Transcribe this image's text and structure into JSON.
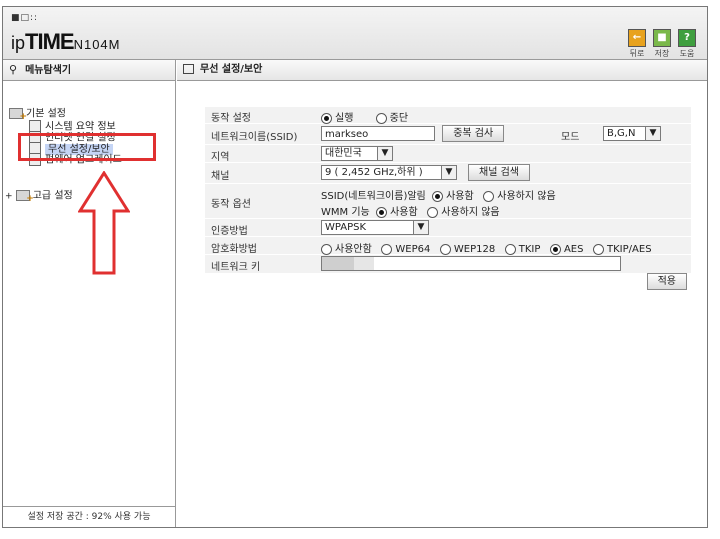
{
  "header": {
    "dots": "■□::",
    "logo_ip": "ip",
    "logo_time": "TIME",
    "logo_model": "N104M",
    "tools": [
      {
        "icon": "back-icon",
        "label": "뒤로",
        "glyph": "←"
      },
      {
        "icon": "save-icon",
        "label": "저장",
        "glyph": "■"
      },
      {
        "icon": "help-icon",
        "label": "도움",
        "glyph": "?"
      }
    ]
  },
  "sidebar": {
    "title": "메뉴탐색기",
    "groups": [
      {
        "label": "기본 설정"
      },
      {
        "label": "고급 설정"
      }
    ],
    "items": [
      {
        "label": "시스템 요약 정보"
      },
      {
        "label": "인터넷 연결 설정"
      },
      {
        "label": "무선 설정/보안"
      },
      {
        "label": "펌웨어 업그레이드"
      }
    ],
    "storage": "설정 저장 공간 : 92% 사용 가능"
  },
  "main": {
    "title": "무선 설정/보안",
    "form": {
      "operation": {
        "label": "동작 설정",
        "on": "실행",
        "off": "중단",
        "selected": "실행"
      },
      "ssid": {
        "label": "네트워크이름(SSID)",
        "value": "markseo",
        "dup_check": "중복 검사",
        "mode_label": "모드",
        "mode_value": "B,G,N"
      },
      "region": {
        "label": "지역",
        "value": "대한민국"
      },
      "channel": {
        "label": "채널",
        "value": "9 ( 2,452 GHz,하위 )",
        "search": "채널 검색"
      },
      "options": {
        "label": "동작 옵션",
        "ssid_broadcast": "SSID(네트워크이름)알림",
        "wmm": "WMM 기능",
        "use": "사용함",
        "nouse": "사용하지 않음"
      },
      "auth": {
        "label": "인증방법",
        "value": "WPAPSK"
      },
      "encryption": {
        "label": "암호화방법",
        "options": [
          "사용안함",
          "WEP64",
          "WEP128",
          "TKIP",
          "AES",
          "TKIP/AES"
        ],
        "selected": "AES"
      },
      "key": {
        "label": "네트워크 키",
        "value": ""
      },
      "apply": "적용"
    }
  },
  "annotation": {
    "color": "#e03030"
  }
}
